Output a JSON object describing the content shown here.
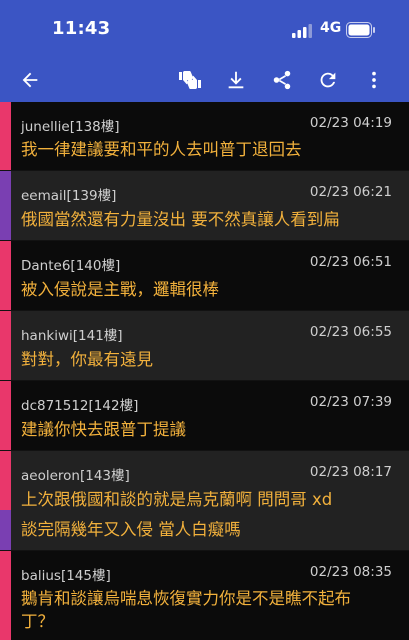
{
  "status_bar": {
    "time": "11:43",
    "network": "4G"
  },
  "toolbar": {
    "icons": [
      "back-arrow-icon",
      "thumbs-up-down-icon",
      "download-icon",
      "share-icon",
      "refresh-icon",
      "more-vert-icon"
    ]
  },
  "colors": {
    "toolbar_bg": "#3b55c4",
    "comment_text": "#f2b13c",
    "bar_pink": "#e9376b",
    "bar_purple": "#7a3fb2"
  },
  "comments": [
    {
      "author": "junellie",
      "floor": "[138樓]",
      "date": "02/23 04:19",
      "lines": [
        "我一律建議要和平的人去叫普丁退回去"
      ]
    },
    {
      "author": "eemail",
      "floor": "[139樓]",
      "date": "02/23 06:21",
      "lines": [
        "俄國當然還有力量沒出 要不然真讓人看到扁"
      ]
    },
    {
      "author": "Dante6",
      "floor": "[140樓]",
      "date": "02/23 06:51",
      "lines": [
        "被入侵說是主戰，邏輯很棒"
      ]
    },
    {
      "author": "hankiwi",
      "floor": "[141樓]",
      "date": "02/23 06:55",
      "lines": [
        "對對，你最有遠見"
      ]
    },
    {
      "author": "dc871512",
      "floor": "[142樓]",
      "date": "02/23 07:39",
      "lines": [
        "建議你快去跟普丁提議"
      ]
    },
    {
      "author": "aeoleron",
      "floor": "[143樓]",
      "date": "02/23 08:17",
      "lines": [
        "上次跟俄國和談的就是烏克蘭啊 問問哥 xd",
        "談完隔幾年又入侵 當人白癡嗎"
      ]
    },
    {
      "author": "balius",
      "floor": "[145樓]",
      "date": "02/23 08:35",
      "lines": [
        "鵝肯和談讓烏喘息恢復實力你是不是瞧不起布",
        "丁？"
      ]
    }
  ]
}
